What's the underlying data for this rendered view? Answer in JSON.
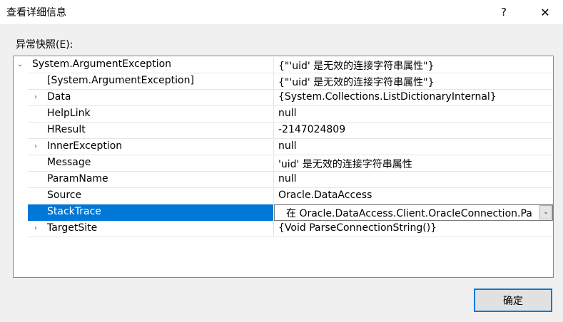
{
  "window": {
    "title": "查看详细信息",
    "help_icon": "?",
    "close_icon": "✕"
  },
  "section_label": "异常快照(E):",
  "grid": {
    "root": {
      "name": "System.ArgumentException",
      "value": "{\"'uid' 是无效的连接字符串属性\"}",
      "expanded": true
    },
    "rows": [
      {
        "name": "[System.ArgumentException]",
        "value": "{\"'uid' 是无效的连接字符串属性\"}",
        "expandable": false
      },
      {
        "name": "Data",
        "value": "{System.Collections.ListDictionaryInternal}",
        "expandable": true
      },
      {
        "name": "HelpLink",
        "value": "null",
        "expandable": false
      },
      {
        "name": "HResult",
        "value": "-2147024809",
        "expandable": false
      },
      {
        "name": "InnerException",
        "value": "null",
        "expandable": true
      },
      {
        "name": "Message",
        "value": "'uid' 是无效的连接字符串属性",
        "expandable": false
      },
      {
        "name": "ParamName",
        "value": "null",
        "expandable": false
      },
      {
        "name": "Source",
        "value": "Oracle.DataAccess",
        "expandable": false
      },
      {
        "name": "StackTrace",
        "value": "在 Oracle.DataAccess.Client.OracleConnection.Pa",
        "expandable": false,
        "selected": true
      },
      {
        "name": "TargetSite",
        "value": "{Void ParseConnectionString()}",
        "expandable": true
      }
    ]
  },
  "ok_button": "确定",
  "colors": {
    "selection": "#0078d7",
    "button_border": "#0078d7"
  }
}
